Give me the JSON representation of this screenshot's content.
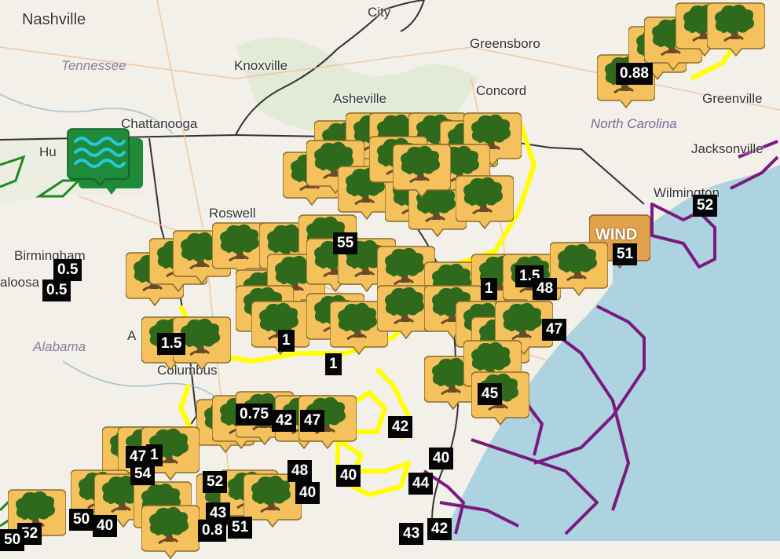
{
  "map": {
    "places": [
      {
        "id": "nashville",
        "label": "Nashville"
      },
      {
        "id": "city",
        "label": "City"
      },
      {
        "id": "greensboro",
        "label": "Greensboro"
      },
      {
        "id": "knoxville",
        "label": "Knoxville"
      },
      {
        "id": "asheville",
        "label": "Asheville"
      },
      {
        "id": "concord",
        "label": "Concord"
      },
      {
        "id": "greenville",
        "label": "Greenville"
      },
      {
        "id": "chattanooga",
        "label": "Chattanooga"
      },
      {
        "id": "huntsville",
        "label": "Hu"
      },
      {
        "id": "jacksonville",
        "label": "Jacksonville"
      },
      {
        "id": "wilmington",
        "label": "Wilmington"
      },
      {
        "id": "roswell",
        "label": "Roswell"
      },
      {
        "id": "birmingham",
        "label": "Birmingham"
      },
      {
        "id": "tuscaloosa",
        "label": "aloosa"
      },
      {
        "id": "columbus",
        "label": "Columbus"
      },
      {
        "id": "atlanta-a",
        "label": "A"
      }
    ],
    "states": [
      {
        "id": "tennessee",
        "label": "Tennessee"
      },
      {
        "id": "north-carolina",
        "label": "North Carolina"
      },
      {
        "id": "alabama",
        "label": "Alabama"
      }
    ],
    "colors": {
      "land": "#f3efe9",
      "water": "#acd3df",
      "tree_pin_fill": "#f4c15d",
      "tree_canopy": "#2f6a1c",
      "tree_trunk": "#6b4a2a",
      "wave_pin_fill": "#1e8a3a",
      "yellow_route": "#ffff00",
      "purple_zone": "#7a1a7e",
      "green_zone": "#1e8a1e",
      "label_box": "#050505"
    },
    "markers": {
      "tree_icon": "tree-report-icon",
      "wave_icon": "flood-water-icon",
      "wind_icon": "wind-report-icon",
      "wind_label": "WIND"
    },
    "values": [
      "0.88",
      "52",
      "51",
      "55",
      "0.5",
      "0.5",
      "1.5",
      "1.5",
      "1",
      "1",
      "1",
      "48",
      "47",
      "45",
      "0.75",
      "42",
      "47",
      "42",
      "47",
      "1",
      "54",
      "52",
      "48",
      "40",
      "40",
      "40",
      "44",
      "43",
      "51",
      "0.8",
      "50",
      "40",
      "52",
      "43",
      "42",
      "50"
    ]
  }
}
